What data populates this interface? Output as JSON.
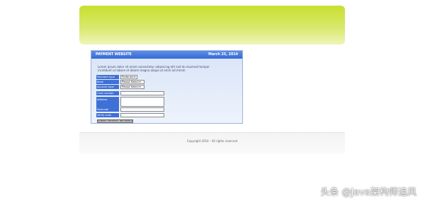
{
  "colors": {
    "banner": "#c9df2f",
    "panel_header": "#3569d6",
    "label_bg": "#3e70d6",
    "panel_bg": "#e4ecfa"
  },
  "panel": {
    "title": "PAYMENT WEBSITE",
    "date": "March 25, 2014",
    "intro_line1": "Lorem ipsum dolor sit amet consectetur adipiscing elit sed do eiusmod tempor",
    "intro_line2": "incididunt ut labore et dolore magna aliqua ut enim ad minim"
  },
  "form": {
    "rows": [
      {
        "label": "Payment type",
        "value": "Preferred"
      },
      {
        "label": "Bank",
        "value": "Please Select"
      },
      {
        "label": "Account type",
        "value": "Please Select"
      },
      {
        "label": "Card number",
        "value": ""
      },
      {
        "label": "Address",
        "value": ""
      },
      {
        "label": "Postcode",
        "value": ""
      },
      {
        "label": "Verify code",
        "value": ""
      }
    ],
    "submit_label": "SUBMIT PAYMENT INFORMATION"
  },
  "footer": {
    "text": "Copyright 2014 - All rights reserved"
  },
  "watermark": {
    "text": "头条 @Java架构师追风"
  }
}
